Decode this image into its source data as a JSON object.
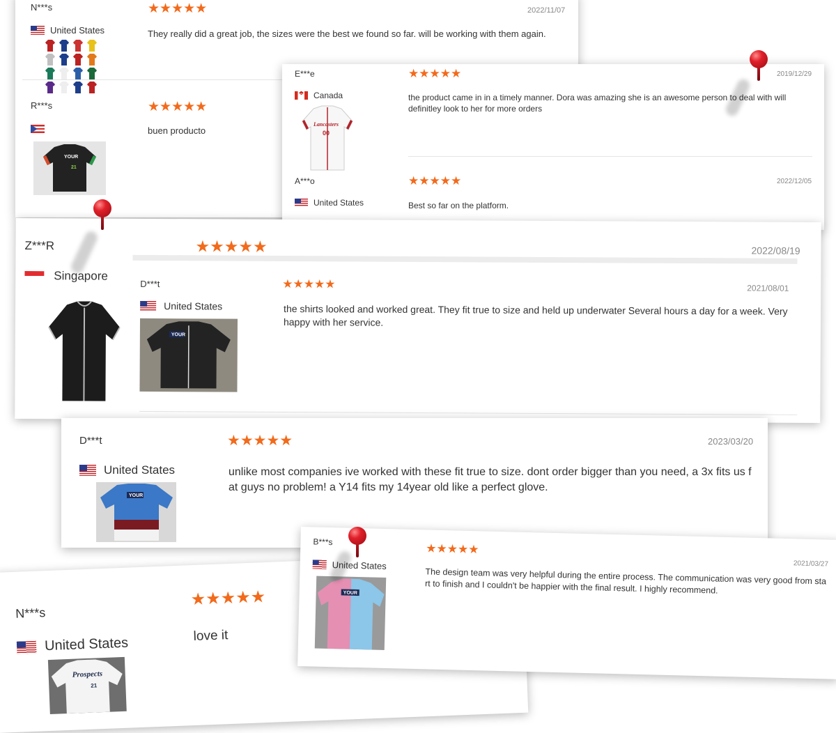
{
  "reviews": [
    {
      "name": "N***s",
      "country": "United States",
      "date": "2022/11/07",
      "stars": "★★★★★",
      "text": "They really did a great job, the sizes were the best we found so far. will be working with them again."
    },
    {
      "name": "R***s",
      "country": "",
      "date": "",
      "stars": "★★★★★",
      "text": "buen producto"
    },
    {
      "name": "E***e",
      "country": "Canada",
      "date": "2019/12/29",
      "stars": "★★★★★",
      "text": "the product came in in a timely manner. Dora was amazing she is an awesome person to deal with will definitley look to her for more orders"
    },
    {
      "name": "A***o",
      "country": "United States",
      "date": "2022/12/05",
      "stars": "★★★★★",
      "text": "Best so far on the platform."
    },
    {
      "name": "Z***R",
      "country": "Singapore",
      "date": "2022/08/19",
      "stars": "★★★★★",
      "text": ""
    },
    {
      "name": "D***t",
      "country": "United States",
      "date": "2021/08/01",
      "stars": "★★★★★",
      "text": "the shirts looked and worked great. They fit true to size and held up underwater Several hours a day for a week. Very happy with her service."
    },
    {
      "name": "D***t",
      "country": "United States",
      "date": "2023/03/20",
      "stars": "★★★★★",
      "text": "unlike most companies ive worked with these fit true to size. dont order bigger than you need, a 3x fits us fat guys no problem! a Y14 fits my 14year old like a perfect glove."
    },
    {
      "name": "B***s",
      "country": "United States",
      "date": "2021/03/27",
      "stars": "★★★★★",
      "text": "The design team was very helpful during the entire process. The communication was very good from start to finish and I couldn't be happier with the final result. I highly recommend."
    },
    {
      "name": "N***s",
      "country": "United States",
      "date": "",
      "stars": "★★★★★",
      "text": "love it"
    }
  ],
  "jersey_prints": {
    "your_logo": "YOUR",
    "number_21": "21",
    "canada_script": "Lancasters",
    "canada_number": "00",
    "white_script": "Prospects",
    "white_number": "21"
  },
  "colors": {
    "star": "#f26a1b",
    "pin": "#e0202a",
    "date": "#888888"
  },
  "icons": [
    "flag-us-icon",
    "flag-ca-icon",
    "flag-pr-icon",
    "flag-sg-icon",
    "push-pin-icon",
    "star-icon"
  ]
}
